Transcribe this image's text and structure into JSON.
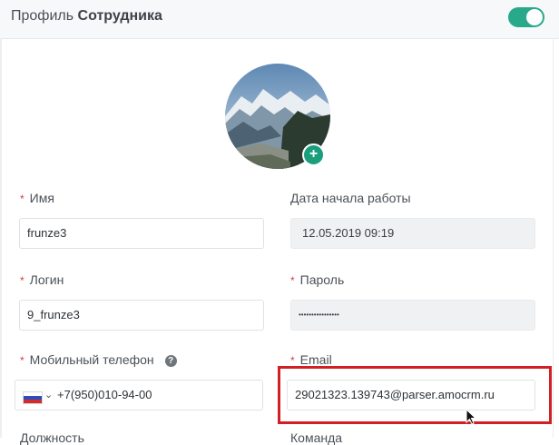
{
  "header": {
    "title_prefix": "Профиль",
    "title_bold": "Сотрудника",
    "toggle_on": true,
    "toggle_color": "#27a98a"
  },
  "avatar": {
    "add_icon": "plus-icon",
    "add_glyph": "+"
  },
  "form": {
    "name": {
      "label": "Имя",
      "required": true,
      "value": "frunze3"
    },
    "start_date": {
      "label": "Дата начала работы",
      "value": "12.05.2019 09:19",
      "disabled": true
    },
    "login": {
      "label": "Логин",
      "required": true,
      "value": "9_frunze3"
    },
    "password": {
      "label": "Пароль",
      "required": true,
      "value": "••••••••••••••••",
      "disabled": true
    },
    "phone": {
      "label": "Мобильный телефон",
      "required": true,
      "value": "+7(950)010-94-00",
      "country_flag": "russia-flag-icon",
      "help_icon": "question-circle-icon",
      "help_glyph": "?"
    },
    "email": {
      "label": "Email",
      "required": true,
      "value": "29021323.139743@parser.amocrm.ru"
    },
    "position": {
      "label": "Должность"
    },
    "team": {
      "label": "Команда"
    }
  },
  "highlight_color": "#d21f26"
}
